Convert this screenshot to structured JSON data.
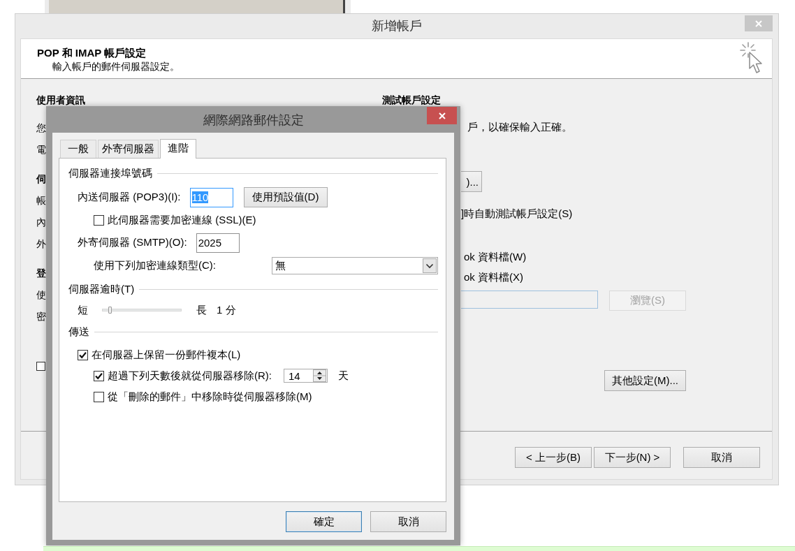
{
  "background_dialog": {
    "title": "新增帳戶",
    "header": {
      "title": "POP 和 IMAP 帳戶設定",
      "subtitle": "輸入帳戶的郵件伺服器設定。"
    },
    "left_sections": [
      {
        "heading": "使用者資訊",
        "labels": [
          "您",
          "電"
        ]
      },
      {
        "heading": "伺",
        "labels": [
          "帳",
          "內",
          "外"
        ]
      },
      {
        "heading": "登",
        "labels": [
          "使",
          "密"
        ]
      }
    ],
    "left_checkbox": {
      "checked": false
    },
    "right_column": {
      "heading": "測試帳戶設定",
      "description": "戶，以確保輸入正確。",
      "test_button": ")...",
      "auto_test_label": "]時自動測試帳戶設定(S)",
      "options": [
        "ok 資料檔(W)",
        "ok 資料檔(X)"
      ],
      "browse_button": {
        "label": "瀏覽(S)",
        "disabled": true
      },
      "more_settings_button": "其他設定(M)..."
    },
    "buttons": [
      "< 上一步(B)",
      "下一步(N) >",
      "取消"
    ]
  },
  "mail_dialog": {
    "title": "網際網路郵件設定",
    "tabs": [
      {
        "label": "一般",
        "selected": false
      },
      {
        "label": "外寄伺服器",
        "selected": false
      },
      {
        "label": "進階",
        "selected": true
      }
    ],
    "groups": [
      {
        "title": "伺服器連接埠號碼",
        "items": [
          {
            "kind": "port",
            "label": "內送伺服器 (POP3)(I):",
            "value": "110",
            "text_selected": true,
            "button": "使用預設值(D)",
            "children": [
              {
                "kind": "checkbox",
                "label": "此伺服器需要加密連線 (SSL)(E)",
                "checked": false
              }
            ]
          },
          {
            "kind": "port",
            "label": "外寄伺服器 (SMTP)(O):",
            "value": "2025",
            "text_selected": false,
            "children": [
              {
                "kind": "select",
                "label": "使用下列加密連線類型(C):",
                "value": "無"
              }
            ]
          }
        ]
      },
      {
        "title": "伺服器逾時(T)",
        "items": [
          {
            "kind": "slider",
            "min_label": "短",
            "max_label": "長",
            "level": 0.1,
            "reading": "1 分"
          }
        ]
      },
      {
        "title": "傳送",
        "items": [
          {
            "kind": "checkbox",
            "label": "在伺服器上保留一份郵件複本(L)",
            "checked": true,
            "children": [
              {
                "kind": "spin",
                "label": "超過下列天數後就從伺服器移除(R):",
                "checked": true,
                "value": "14",
                "unit": "天"
              },
              {
                "kind": "checkbox",
                "label": "從「刪除的郵件」中移除時從伺服器移除(M)",
                "checked": false
              }
            ]
          }
        ]
      }
    ],
    "buttons": [
      {
        "label": "確定",
        "default": true
      },
      {
        "label": "取消",
        "default": false
      }
    ]
  }
}
